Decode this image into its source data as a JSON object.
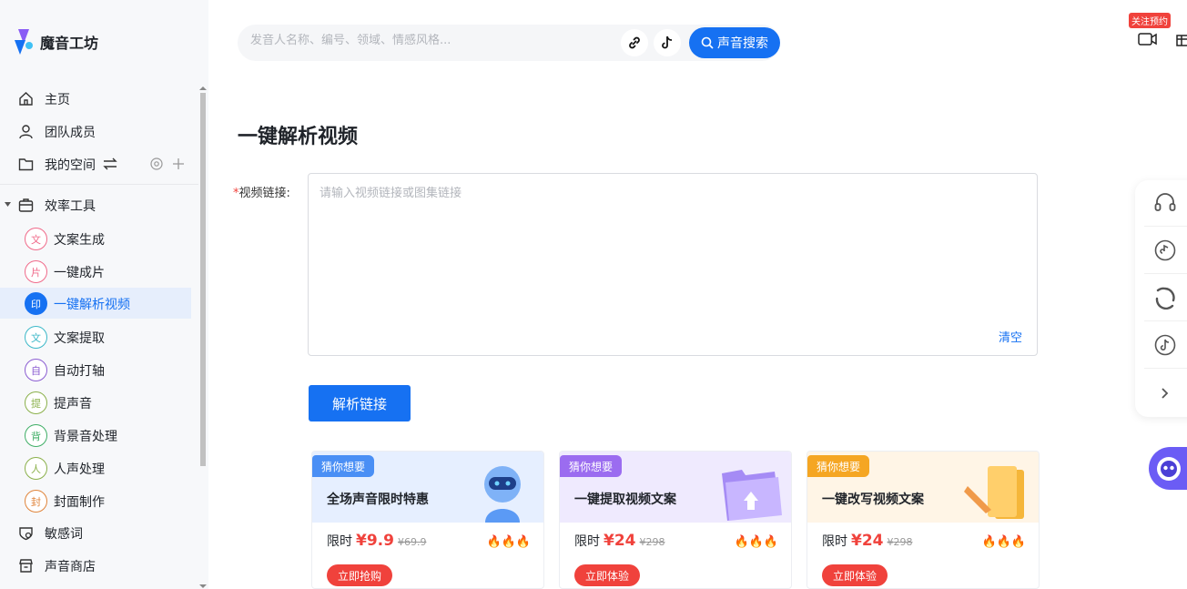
{
  "app": {
    "name": "魔音工坊"
  },
  "sidebar": {
    "nav_top": [
      {
        "label": "主页",
        "icon": "home-icon"
      },
      {
        "label": "团队成员",
        "icon": "user-icon"
      },
      {
        "label": "我的空间",
        "icon": "folder-icon"
      }
    ],
    "group": {
      "label": "效率工具",
      "icon": "toolbox-icon"
    },
    "tools": [
      {
        "glyph": "文",
        "label": "文案生成",
        "color": "#f06a8a"
      },
      {
        "glyph": "片",
        "label": "一键成片",
        "color": "#f06a8a"
      },
      {
        "glyph": "印",
        "label": "一键解析视频",
        "color": "#1671f2",
        "active": true
      },
      {
        "glyph": "文",
        "label": "文案提取",
        "color": "#3cb8c8"
      },
      {
        "glyph": "自",
        "label": "自动打轴",
        "color": "#8a5cd1"
      },
      {
        "glyph": "提",
        "label": "提声音",
        "color": "#8ab04a"
      },
      {
        "glyph": "背",
        "label": "背景音处理",
        "color": "#3fae66"
      },
      {
        "glyph": "人",
        "label": "人声处理",
        "color": "#8ab04a"
      },
      {
        "glyph": "封",
        "label": "封面制作",
        "color": "#e0843a"
      }
    ],
    "nav_bottom": [
      {
        "label": "敏感词",
        "icon": "shield-search-icon"
      },
      {
        "label": "声音商店",
        "icon": "store-icon"
      }
    ]
  },
  "search": {
    "placeholder": "发音人名称、编号、领域、情感风格...",
    "button_label": "声音搜索"
  },
  "top_right": {
    "badge": "关注预约"
  },
  "main": {
    "title": "一键解析视频",
    "field_required_mark": "*",
    "field_label": "视频链接:",
    "textarea_placeholder": "请输入视频链接或图集链接",
    "clear_label": "清空",
    "parse_button": "解析链接"
  },
  "cards": [
    {
      "tag": "猜你想要",
      "tag_color": "#4a8ff5",
      "title": "全场声音限时特惠",
      "price_prefix": "限时",
      "price": "¥9.9",
      "old_price": "¥69.9",
      "fire": "🔥🔥🔥",
      "button": "立即抢购",
      "bg": "#e6efff"
    },
    {
      "tag": "猜你想要",
      "tag_color": "#9b6cf0",
      "title": "一键提取视频文案",
      "price_prefix": "限时",
      "price": "¥24",
      "old_price": "¥298",
      "fire": "🔥🔥🔥",
      "button": "立即体验",
      "bg": "#efeafe"
    },
    {
      "tag": "猜你想要",
      "tag_color": "#f5a623",
      "title": "一键改写视频文案",
      "price_prefix": "限时",
      "price": "¥24",
      "old_price": "¥298",
      "fire": "🔥🔥🔥",
      "button": "立即体验",
      "bg": "#fff5e6"
    }
  ],
  "float_bar": [
    "headset-icon",
    "music-link-icon",
    "refresh-icon",
    "tiktok-icon",
    "chevron-right-icon"
  ]
}
